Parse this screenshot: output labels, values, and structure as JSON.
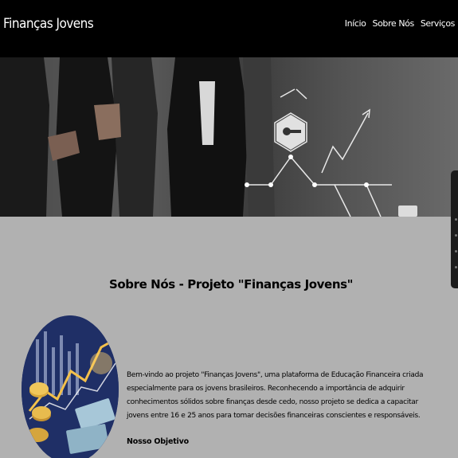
{
  "header": {
    "brand": "Finanças Jovens",
    "nav": [
      "Início",
      "Sobre Nós",
      "Serviços"
    ]
  },
  "hero": {
    "image_alt": "Pessoas de terno com ícones de finanças"
  },
  "about": {
    "title": "Sobre Nós - Projeto \"Finanças Jovens\"",
    "intro": "Bem-vindo ao projeto \"Finanças Jovens\", uma plataforma de Educação Financeira criada especialmente para os jovens brasileiros. Reconhecendo a importância de adquirir conhecimentos sólidos sobre finanças desde cedo, nosso projeto se dedica a capacitar jovens entre 16 e 25 anos para tomar decisões financeiras conscientes e responsáveis.",
    "subheading": "Nosso Objetivo"
  },
  "colors": {
    "header_bg": "#000000",
    "page_bg": "#b1b1b1"
  }
}
